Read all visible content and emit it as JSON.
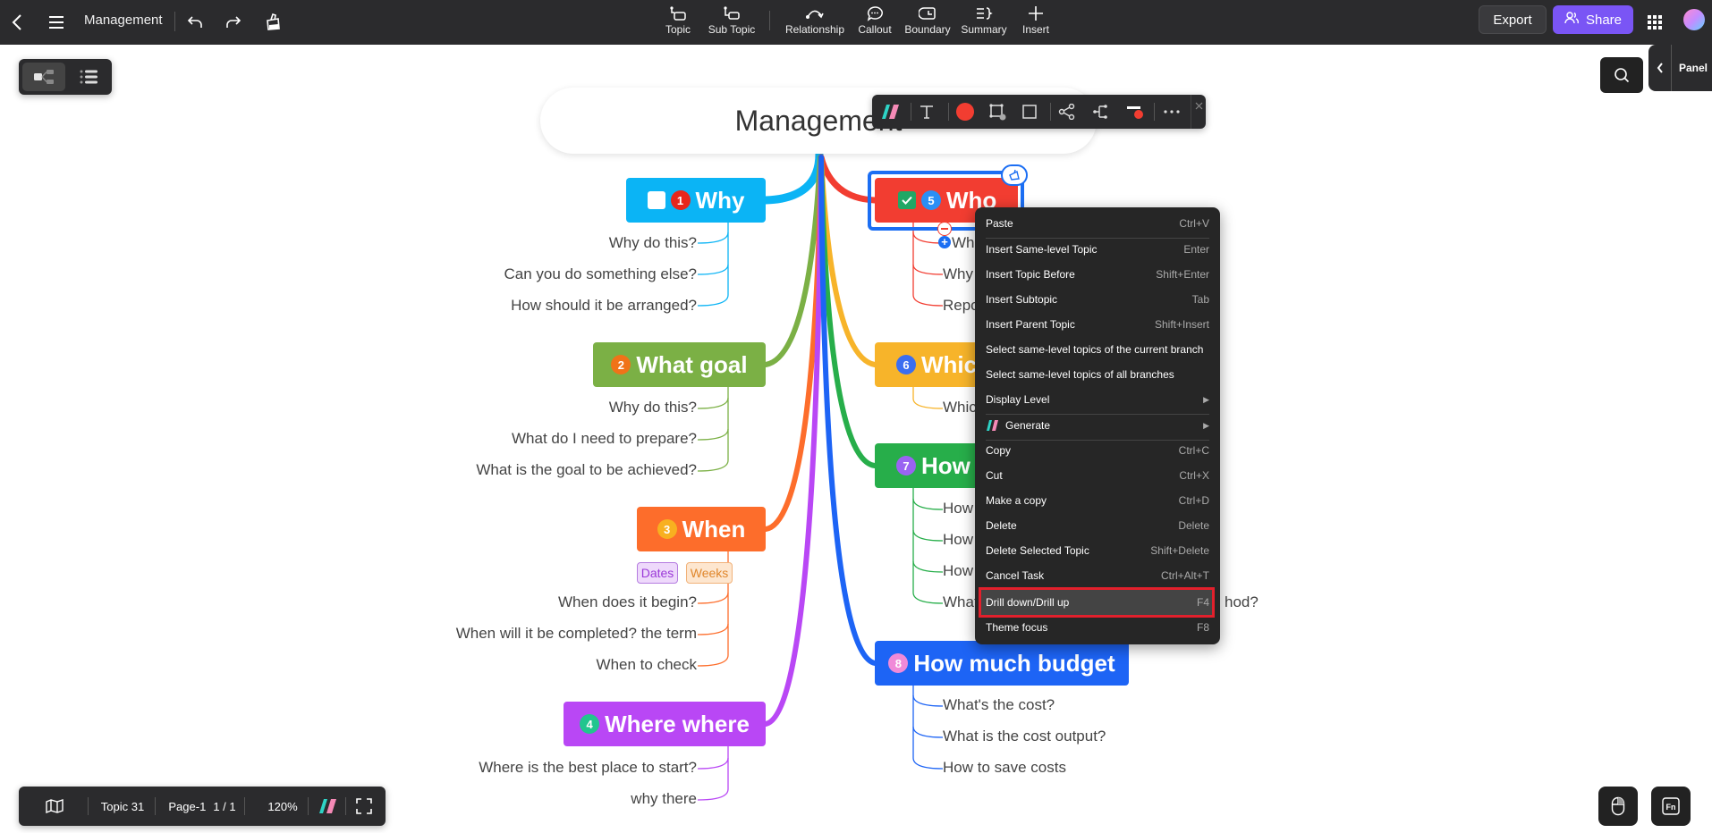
{
  "app": {
    "doc_title": "Management",
    "colors": {
      "topbar": "#2b2b2d",
      "accent": "#7a55f5",
      "selection": "#1b6ef3",
      "highlight": "#e2202c"
    }
  },
  "topbar": {
    "icons": [
      "back-icon",
      "menu-icon",
      "undo-icon",
      "redo-icon",
      "format-painter-icon"
    ],
    "tools": [
      {
        "label": "Topic",
        "icon": "topic-icon"
      },
      {
        "label": "Sub Topic",
        "icon": "subtopic-icon"
      },
      {
        "label": "Relationship",
        "icon": "relationship-icon"
      },
      {
        "label": "Callout",
        "icon": "callout-icon"
      },
      {
        "label": "Boundary",
        "icon": "boundary-icon"
      },
      {
        "label": "Summary",
        "icon": "summary-icon"
      },
      {
        "label": "Insert",
        "icon": "plus-icon"
      }
    ],
    "export_label": "Export",
    "share_label": "Share"
  },
  "side": {
    "panel_label": "Panel"
  },
  "mindmap": {
    "root": "Management",
    "left": [
      {
        "num": "1",
        "title": "Why",
        "color": "#0bb4f5",
        "badge_color": "#e8261c",
        "checkbox": false,
        "children": [
          "Why do this?",
          "Can you do something else?",
          "How should it be arranged?"
        ]
      },
      {
        "num": "2",
        "title": "What goal",
        "color": "#7bb045",
        "badge_color": "#f07318",
        "children": [
          "Why do this?",
          "What do I need to prepare?",
          "What is the goal to be achieved?"
        ]
      },
      {
        "num": "3",
        "title": "When",
        "color": "#fd6d2b",
        "badge_color": "#f8b020",
        "tags": [
          {
            "label": "Dates",
            "bg": "#eed9fb",
            "fg": "#9b39d8",
            "border": "#b57ce0"
          },
          {
            "label": "Weeks",
            "bg": "#fde6cf",
            "fg": "#e0872c",
            "border": "#f1b27a"
          }
        ],
        "children": [
          "When does it begin?",
          "When will it be completed? the term",
          "When to check"
        ]
      },
      {
        "num": "4",
        "title": "Where where",
        "color": "#b947f5",
        "badge_color": "#22c58e",
        "children": [
          "Where is the best place to start?",
          "why there"
        ]
      }
    ],
    "right": [
      {
        "num": "5",
        "title": "Who",
        "color": "#f23d31",
        "badge_color": "#2b8ff5",
        "checkbox": true,
        "children": [
          "Who",
          "Why",
          "Repo"
        ]
      },
      {
        "num": "6",
        "title": "Which",
        "color": "#f7b42a",
        "badge_color": "#3b6ef0",
        "children": [
          "Whic"
        ]
      },
      {
        "num": "7",
        "title": "How t",
        "color": "#27ae4a",
        "badge_color": "#9a63f2",
        "children": [
          "How",
          "How",
          "How",
          "What",
          "hod?"
        ]
      },
      {
        "num": "8",
        "title": "How much budget",
        "color": "#1d64f5",
        "badge_color": "#f08ad8",
        "children": [
          "What's the cost?",
          "What is the cost output?",
          "How to save costs"
        ]
      }
    ]
  },
  "context_menu": {
    "items": [
      {
        "label": "Paste",
        "key": "Ctrl+V"
      },
      {
        "label": "Insert Same-level Topic",
        "key": "Enter"
      },
      {
        "label": "Insert Topic Before",
        "key": "Shift+Enter"
      },
      {
        "label": "Insert Subtopic",
        "key": "Tab"
      },
      {
        "label": "Insert Parent Topic",
        "key": "Shift+Insert"
      },
      {
        "label": "Select same-level topics of the current branch",
        "key": ""
      },
      {
        "label": "Select same-level topics of all branches",
        "key": ""
      },
      {
        "label": "Display Level",
        "key": "▶"
      },
      {
        "label": "Generate",
        "key": "▶"
      },
      {
        "label": "Copy",
        "key": "Ctrl+C"
      },
      {
        "label": "Cut",
        "key": "Ctrl+X"
      },
      {
        "label": "Make a copy",
        "key": "Ctrl+D"
      },
      {
        "label": "Delete",
        "key": "Delete"
      },
      {
        "label": "Delete Selected Topic",
        "key": "Shift+Delete"
      },
      {
        "label": "Cancel Task",
        "key": "Ctrl+Alt+T"
      },
      {
        "label": "Drill down/Drill up",
        "key": "F4"
      },
      {
        "label": "Theme focus",
        "key": "F8"
      }
    ],
    "highlighted": "Drill down/Drill up"
  },
  "bottombar": {
    "topic_count": "Topic 31",
    "page": "Page-1",
    "page_of": "1 / 1",
    "zoom": "120%"
  }
}
